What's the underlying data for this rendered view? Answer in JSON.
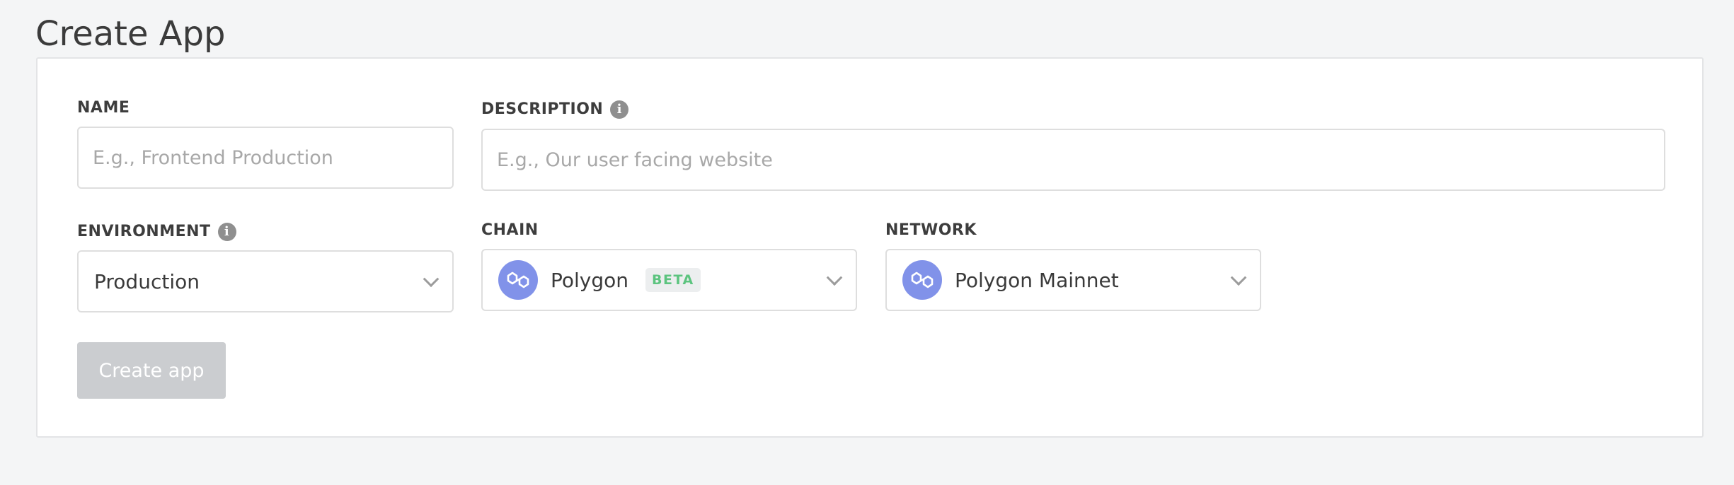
{
  "page": {
    "title": "Create App"
  },
  "form": {
    "name": {
      "label": "NAME",
      "value": "",
      "placeholder": "E.g., Frontend Production"
    },
    "description": {
      "label": "DESCRIPTION",
      "value": "",
      "placeholder": "E.g., Our user facing website",
      "info_icon": "info-icon"
    },
    "environment": {
      "label": "ENVIRONMENT",
      "value": "Production",
      "info_icon": "info-icon"
    },
    "chain": {
      "label": "CHAIN",
      "value": "Polygon",
      "badge": "BETA",
      "icon": "polygon-icon"
    },
    "network": {
      "label": "NETWORK",
      "value": "Polygon Mainnet",
      "icon": "polygon-icon"
    },
    "submit_label": "Create app"
  },
  "colors": {
    "background": "#f4f5f6",
    "polygon_icon": "#8192e9",
    "beta_badge_text": "#5cc47f",
    "button_disabled": "#cbcdd0"
  }
}
